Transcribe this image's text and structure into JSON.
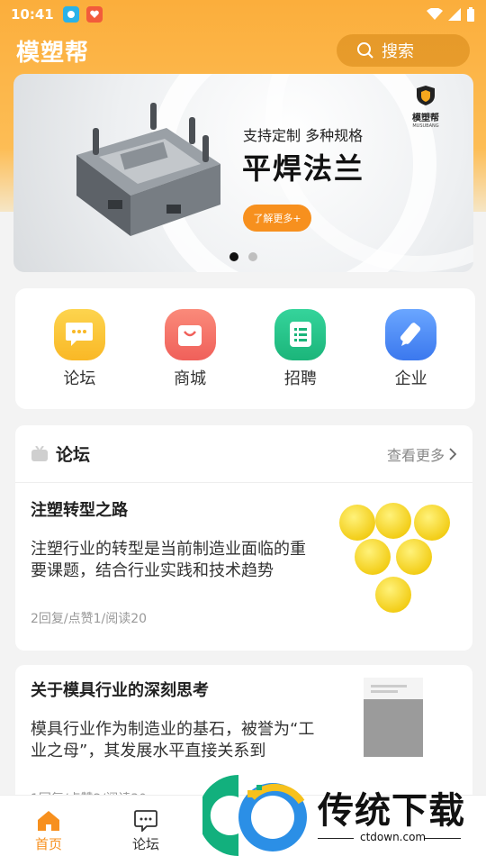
{
  "status": {
    "time": "10:41"
  },
  "app": {
    "title": "模塑帮"
  },
  "search": {
    "label": "搜索"
  },
  "banner": {
    "subtitle": "支持定制 多种规格",
    "title": "平焊法兰",
    "button": "了解更多+",
    "brand": "模塑帮",
    "brand_sub": "MUSUBANG",
    "active_slide": 1,
    "slide_count": 2
  },
  "quick": [
    {
      "label": "论坛",
      "icon": "chat-bubble-icon",
      "color": "#fcc53a"
    },
    {
      "label": "商城",
      "icon": "shopping-bag-icon",
      "color": "#f8716a"
    },
    {
      "label": "招聘",
      "icon": "document-list-icon",
      "color": "#28c68b"
    },
    {
      "label": "企业",
      "icon": "pencil-icon",
      "color": "#4a8cf5"
    }
  ],
  "forum": {
    "title": "论坛",
    "more": "查看更多",
    "posts": [
      {
        "title": "注塑转型之路",
        "body": "注塑行业的转型是当前制造业面临的重要课题，结合行业实践和技术趋势",
        "meta": "2回复/点赞1/阅读20"
      },
      {
        "title": "关于模具行业的深刻思考",
        "body": "模具行业作为制造业的基石，被誉为“工业之母”，其发展水平直接关系到",
        "meta": "1回复/点赞2/阅读30"
      }
    ]
  },
  "nav": [
    {
      "label": "首页",
      "active": true
    },
    {
      "label": "论坛",
      "active": false
    }
  ],
  "watermark": {
    "text": "传统下载",
    "url": "ctdown.com"
  },
  "colors": {
    "accent": "#f7901e",
    "header": "#fbae3c"
  }
}
